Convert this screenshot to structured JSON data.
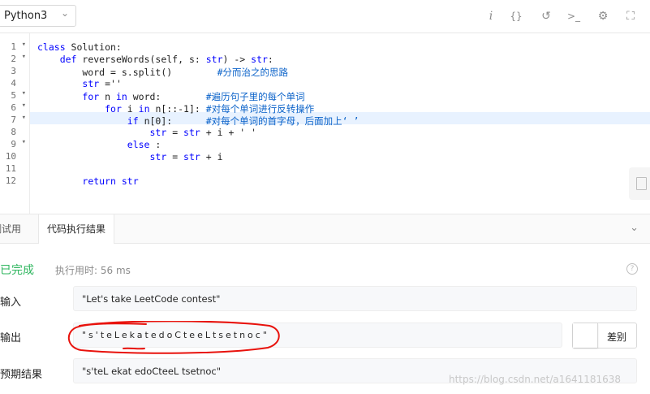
{
  "toolbar": {
    "language": "Python3",
    "icons": [
      "info-icon",
      "braces-icon",
      "reset-icon",
      "terminal-icon",
      "settings-icon",
      "fullscreen-icon"
    ]
  },
  "editor": {
    "line_numbers": [
      "1",
      "2",
      "3",
      "4",
      "5",
      "6",
      "7",
      "8",
      "9",
      "10",
      "11",
      "12"
    ],
    "lines": [
      "class Solution:",
      "    def reverseWords(self, s: str) -> str:",
      "        word = s.split()        #分而治之的思路",
      "        str =''",
      "        for n in word:        #遍历句子里的每个单词",
      "            for i in n[::-1]: #对每个单词进行反转操作",
      "                if n[0]:      #对每个单词的首字母，后面加上‘ ’",
      "                    str = str + i + ' '",
      "                else :",
      "                    str = str + i",
      "",
      "        return str"
    ]
  },
  "tabs": {
    "testcase": "测试用例",
    "result": "代码执行结果"
  },
  "result": {
    "status": "已完成",
    "runtime": "执行用时: 56 ms",
    "help": "?",
    "input_label": "输入",
    "input_value": "\"Let's take LeetCode contest\"",
    "output_label": "输出",
    "output_value": "\"s'teLekatedoCteeLtsetnoc\"",
    "diff_label": "差别",
    "expected_label": "预期结果",
    "expected_value": "\"s'teL ekat edoCteeL tsetnoc\""
  },
  "watermark": "https://blog.csdn.net/a1641181638",
  "colors": {
    "status_green": "#2db55d",
    "keyword_blue": "#0000ff",
    "comment_blue": "#0a62c9",
    "annotation_red": "#e8120c",
    "highlight_line": "#e8f2ff"
  }
}
